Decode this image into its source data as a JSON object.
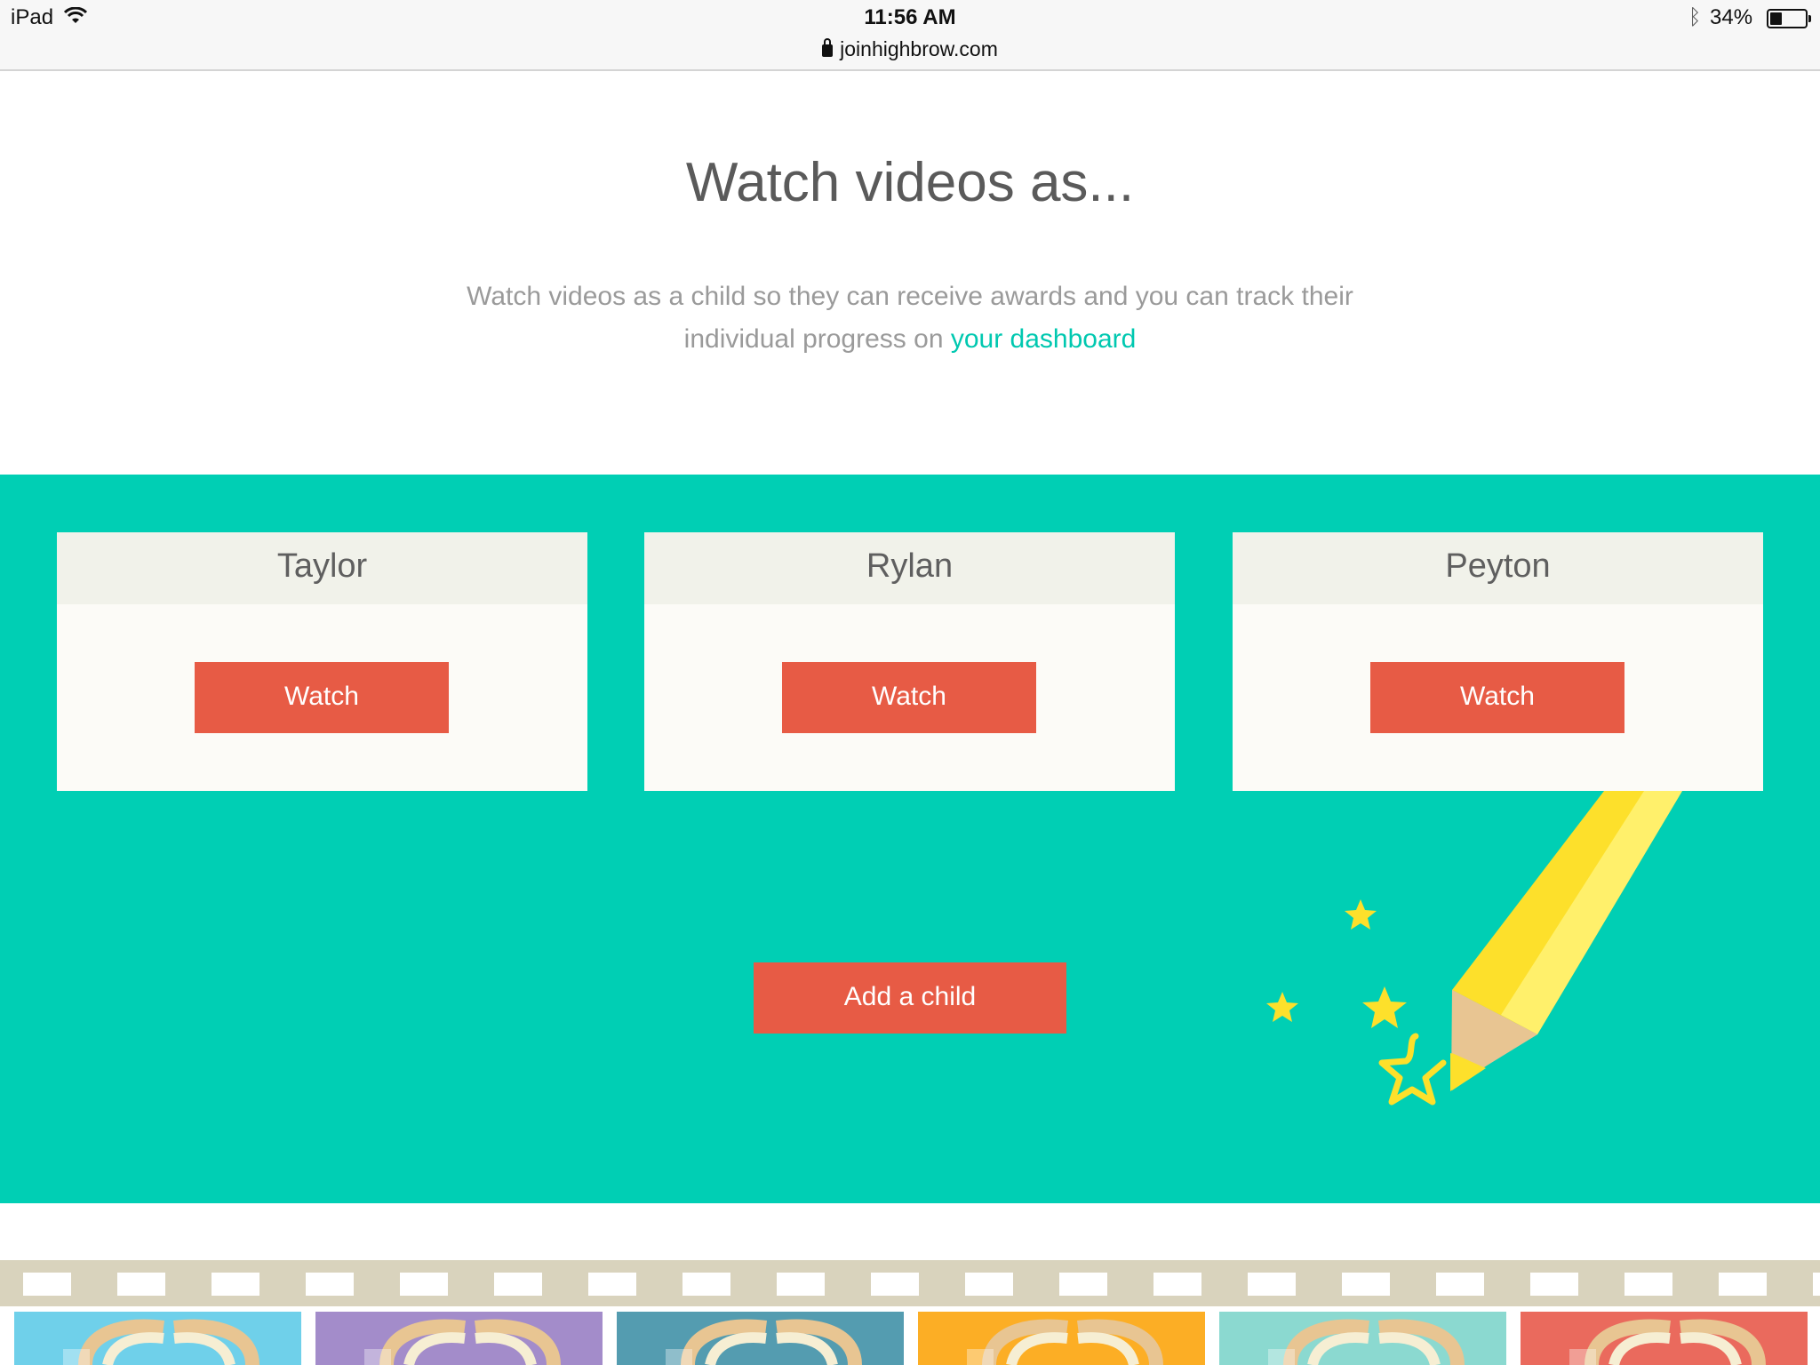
{
  "status_bar": {
    "device": "iPad",
    "time": "11:56 AM",
    "url": "joinhighbrow.com",
    "battery": "34%",
    "battery_level": 0.34,
    "icons": [
      "wifi-icon",
      "lock-icon",
      "bluetooth-icon",
      "battery-icon"
    ]
  },
  "page": {
    "title": "Watch videos as...",
    "subtitle": "Watch videos as a child so they can receive awards and you can track their individual progress on",
    "dashboard_link": "your dashboard"
  },
  "children": [
    {
      "name": "Taylor",
      "button": "Watch"
    },
    {
      "name": "Rylan",
      "button": "Watch"
    },
    {
      "name": "Peyton",
      "button": "Watch"
    }
  ],
  "add_child_button": "Add a child",
  "colors": {
    "teal": "#00cfb4",
    "button": "#e75b45",
    "link": "#00c8b0",
    "card": "#fcfbf7",
    "card_header": "#f1f2ea",
    "thumbs": [
      "#6fd0ea",
      "#a38cca",
      "#549cb0",
      "#fcae25",
      "#8bd9d0",
      "#ea6a5d"
    ]
  }
}
